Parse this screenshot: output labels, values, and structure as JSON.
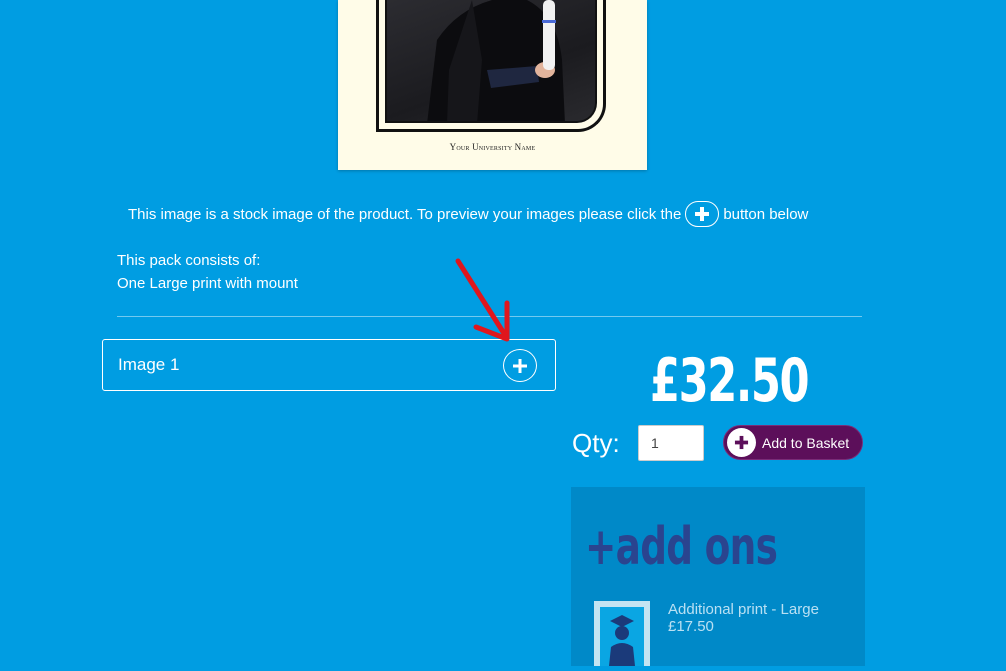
{
  "preview": {
    "university_name": "Your University Name"
  },
  "info": {
    "before": "This image is a stock image of the product. To preview your images please click the",
    "after": "button below"
  },
  "pack": {
    "heading": "This pack consists of:",
    "item": "One Large print with mount"
  },
  "slots": [
    {
      "label": "Image 1",
      "add_icon": "plus-circle-icon"
    }
  ],
  "annotation": {
    "icon": "red-arrow-icon",
    "color": "#e0161d"
  },
  "product": {
    "price": "£32.50",
    "qty_label": "Qty:",
    "qty_value": "1",
    "add_to_basket_label": "Add to Basket",
    "button_color": "#5c0f5a"
  },
  "addons": {
    "title": "+add ons",
    "items": [
      {
        "name": "Additional print - Large",
        "price": "£17.50",
        "icon": "graduate-icon"
      }
    ]
  },
  "colors": {
    "background": "#009de2",
    "addons_panel": "#0089c8",
    "addons_title": "#2a448f"
  }
}
